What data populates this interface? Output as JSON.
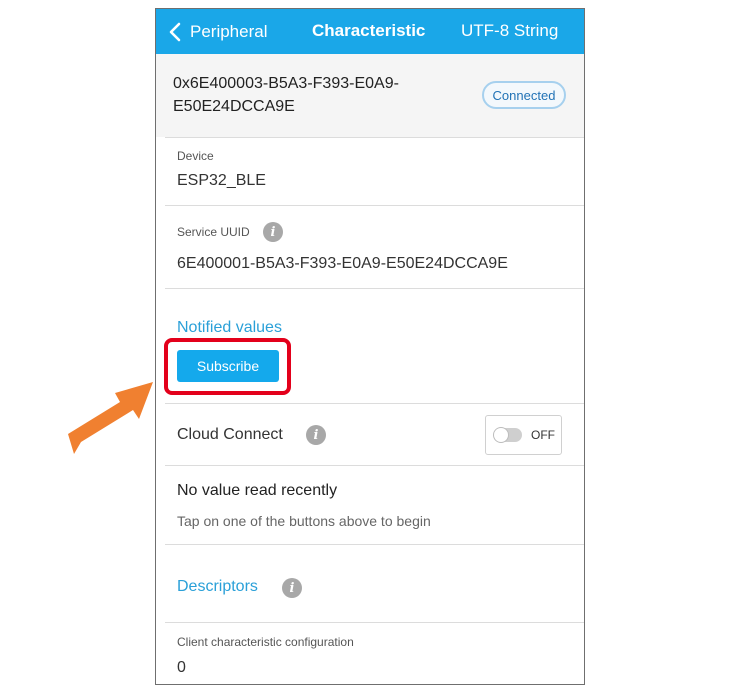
{
  "navbar": {
    "back_label": "Peripheral",
    "title": "Characteristic",
    "right_label": "UTF-8 String"
  },
  "characteristic": {
    "uuid_line1": "0x6E400003-B5A3-F393-E0A9-",
    "uuid_line2": "E50E24DCCA9E",
    "status": "Connected"
  },
  "device": {
    "label": "Device",
    "value": "ESP32_BLE"
  },
  "service": {
    "label": "Service UUID",
    "value": "6E400001-B5A3-F393-E0A9-E50E24DCCA9E"
  },
  "notified": {
    "heading": "Notified values",
    "subscribe_label": "Subscribe"
  },
  "cloud": {
    "label": "Cloud Connect",
    "toggle_state": "OFF"
  },
  "read_status": {
    "title": "No value read recently",
    "hint": "Tap on one of the buttons above to begin"
  },
  "descriptors": {
    "heading": "Descriptors",
    "item_label": "Client characteristic configuration",
    "item_value": "0"
  },
  "info_glyph": "i",
  "colors": {
    "accent": "#1aa7e8",
    "highlight": "#e3001b",
    "arrow": "#f08030"
  }
}
